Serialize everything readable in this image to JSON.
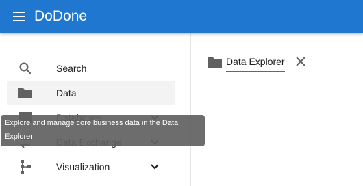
{
  "app": {
    "title": "DoDone",
    "brand_color": "#1f77d0"
  },
  "sidebar": {
    "items": [
      {
        "label": "Search",
        "icon": "search-icon",
        "selected": false
      },
      {
        "label": "Data",
        "icon": "folder-icon",
        "selected": true
      },
      {
        "label": "Databases",
        "icon": "database-icon",
        "expandable": true
      },
      {
        "label": "Data Exchange",
        "icon": "exchange-icon",
        "expandable": true
      },
      {
        "label": "Visualization",
        "icon": "hierarchy-icon",
        "expandable": true
      }
    ]
  },
  "tooltip": {
    "text": "Explore and manage core business data in the Data Explorer"
  },
  "tabs": [
    {
      "label": "Data Explorer",
      "icon": "folder-icon",
      "active": true,
      "closable": true
    }
  ]
}
